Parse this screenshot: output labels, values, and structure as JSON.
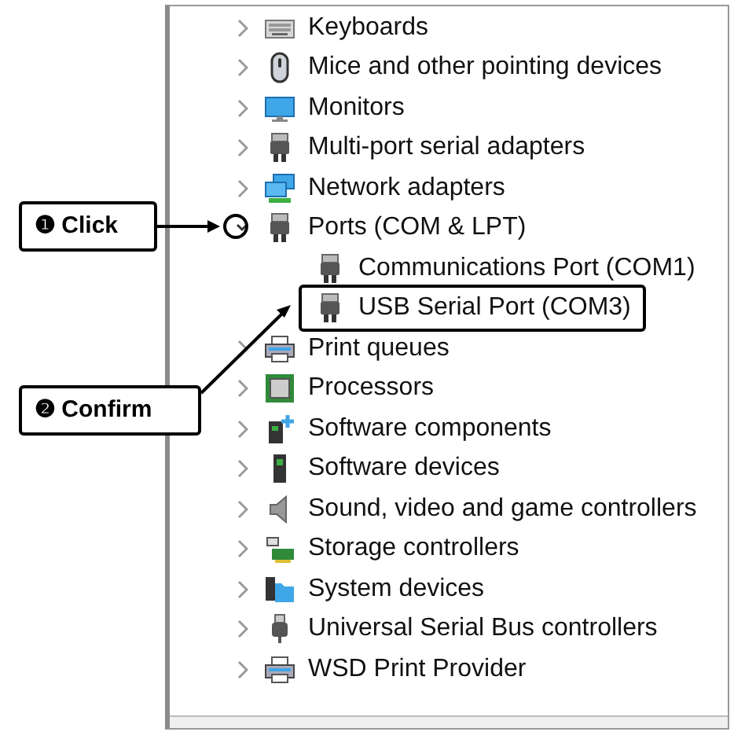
{
  "device_tree": [
    {
      "label": "Keyboards",
      "kind": "keyboard",
      "expanded": false
    },
    {
      "label": "Mice and other pointing devices",
      "kind": "mouse",
      "expanded": false
    },
    {
      "label": "Monitors",
      "kind": "monitor",
      "expanded": false
    },
    {
      "label": "Multi-port serial adapters",
      "kind": "port",
      "expanded": false
    },
    {
      "label": "Network adapters",
      "kind": "network",
      "expanded": false
    },
    {
      "label": "Ports (COM & LPT)",
      "kind": "port",
      "expanded": true,
      "children": [
        {
          "label": "Communications Port (COM1)",
          "kind": "port",
          "highlighted": false
        },
        {
          "label": "USB Serial Port (COM3)",
          "kind": "port",
          "highlighted": true
        }
      ]
    },
    {
      "label": "Print queues",
      "kind": "printer",
      "expanded": false
    },
    {
      "label": "Processors",
      "kind": "processor",
      "expanded": false
    },
    {
      "label": "Software components",
      "kind": "component",
      "expanded": false
    },
    {
      "label": "Software devices",
      "kind": "softdevice",
      "expanded": false
    },
    {
      "label": "Sound, video and game controllers",
      "kind": "speaker",
      "expanded": false
    },
    {
      "label": "Storage controllers",
      "kind": "storage",
      "expanded": false
    },
    {
      "label": "System devices",
      "kind": "system",
      "expanded": false
    },
    {
      "label": "Universal Serial Bus controllers",
      "kind": "usb",
      "expanded": false
    },
    {
      "label": "WSD Print Provider",
      "kind": "printer",
      "expanded": false
    }
  ],
  "callouts": [
    {
      "text": "❶ Click"
    },
    {
      "text": "❷ Confirm"
    }
  ]
}
